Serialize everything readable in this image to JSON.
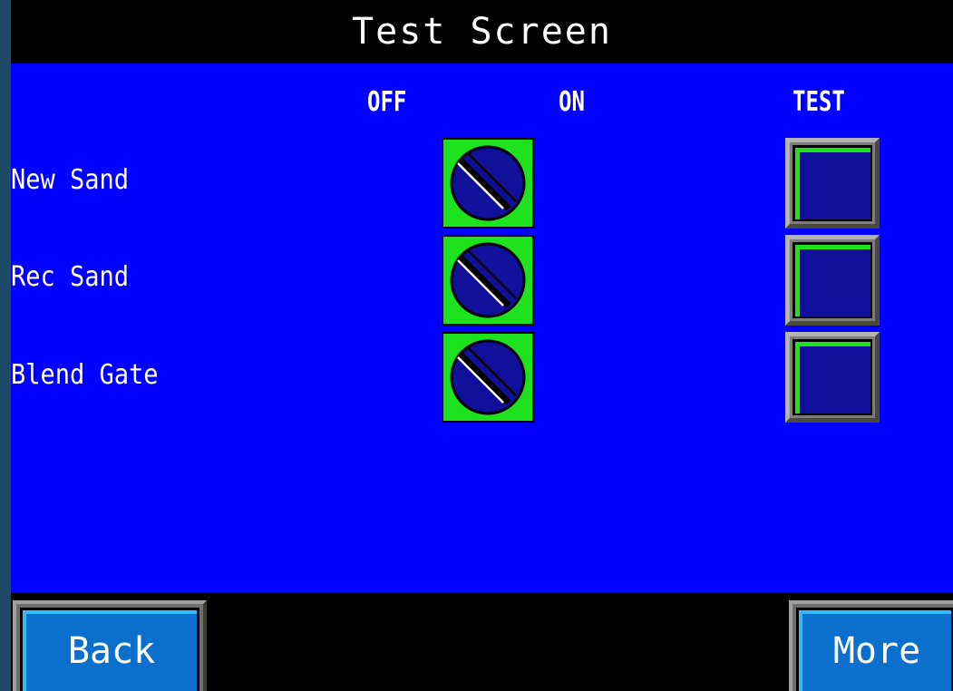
{
  "title": "Test Screen",
  "columns": {
    "off": "OFF",
    "on": "ON",
    "test": "TEST"
  },
  "rows": [
    {
      "label": "New Sand",
      "selector_state": "OFF"
    },
    {
      "label": "Rec Sand",
      "selector_state": "OFF"
    },
    {
      "label": "Blend Gate",
      "selector_state": "OFF"
    }
  ],
  "nav": {
    "back_label": "Back",
    "more_label": "More"
  },
  "colors": {
    "panel": "#0000ff",
    "selector_bg": "#1fe21f",
    "knob": "#10109a",
    "nav_face": "#0b6fce"
  }
}
